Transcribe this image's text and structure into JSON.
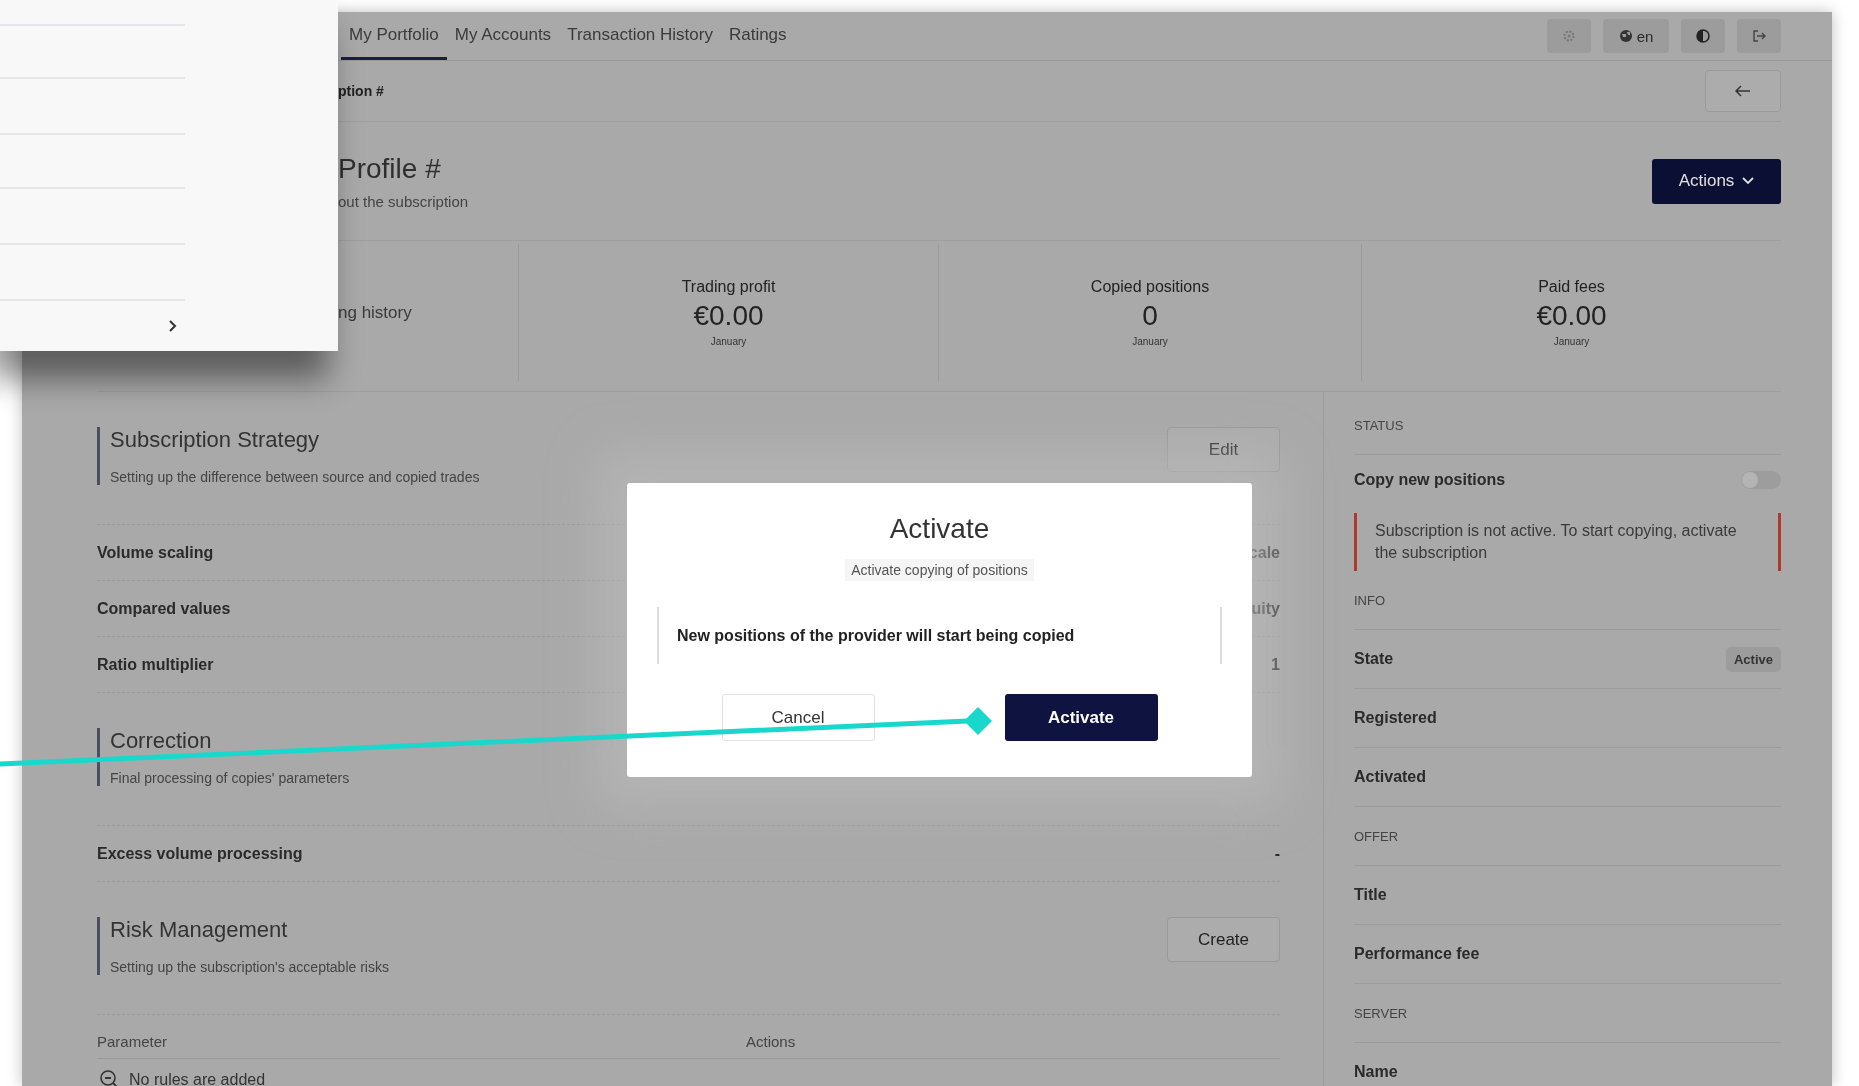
{
  "nav": {
    "tabs": [
      {
        "label": "My Portfolio",
        "selected": true
      },
      {
        "label": "My Accounts",
        "selected": false
      },
      {
        "label": "Transaction History",
        "selected": false
      },
      {
        "label": "Ratings",
        "selected": false
      }
    ],
    "language": "en"
  },
  "breadcrumb": "ption #",
  "header": {
    "title": "Profile #",
    "subtitle": "out the subscription",
    "actions_button": "Actions"
  },
  "stats": {
    "history_link": "ng history",
    "cards": [
      {
        "label": "Trading profit",
        "value": "€0.00",
        "period": "January"
      },
      {
        "label": "Copied positions",
        "value": "0",
        "period": "January"
      },
      {
        "label": "Paid fees",
        "value": "€0.00",
        "period": "January"
      }
    ]
  },
  "sections": [
    {
      "title": "Subscription Strategy",
      "description": "Setting up the difference between source and copied trades",
      "button": "Edit",
      "rows": [
        {
          "label": "Volume scaling",
          "value": "cale"
        },
        {
          "label": "Compared values",
          "value": "uity"
        },
        {
          "label": "Ratio multiplier",
          "value": "1"
        }
      ]
    },
    {
      "title": "Correction",
      "description": "Final processing of copies' parameters",
      "rows": [
        {
          "label": "Excess volume processing",
          "value": "-"
        }
      ]
    },
    {
      "title": "Risk Management",
      "description": "Setting up the subscription's acceptable risks",
      "button": "Create",
      "table": {
        "columns": [
          "Parameter",
          "Actions"
        ],
        "empty_text": "No rules are added"
      }
    }
  ],
  "side": [
    {
      "kind": "heading",
      "text": "STATUS"
    },
    {
      "kind": "toggle",
      "label": "Copy new positions",
      "on": false
    },
    {
      "kind": "alert",
      "text": "Subscription is not active. To start copying, activate the subscription"
    },
    {
      "kind": "heading",
      "text": "INFO"
    },
    {
      "kind": "field",
      "label": "State",
      "badge": "Active"
    },
    {
      "kind": "field",
      "label": "Registered"
    },
    {
      "kind": "field",
      "label": "Activated"
    },
    {
      "kind": "heading",
      "text": "OFFER"
    },
    {
      "kind": "field",
      "label": "Title"
    },
    {
      "kind": "field",
      "label": "Performance fee"
    },
    {
      "kind": "heading",
      "text": "SERVER"
    },
    {
      "kind": "field",
      "label": "Name"
    }
  ],
  "modal": {
    "title": "Activate",
    "subtitle": "Activate copying of positions",
    "message": "New positions of the provider will start being copied",
    "buttons": [
      {
        "label": "Cancel",
        "kind": "secondary"
      },
      {
        "label": "Activate",
        "kind": "primary"
      }
    ]
  }
}
